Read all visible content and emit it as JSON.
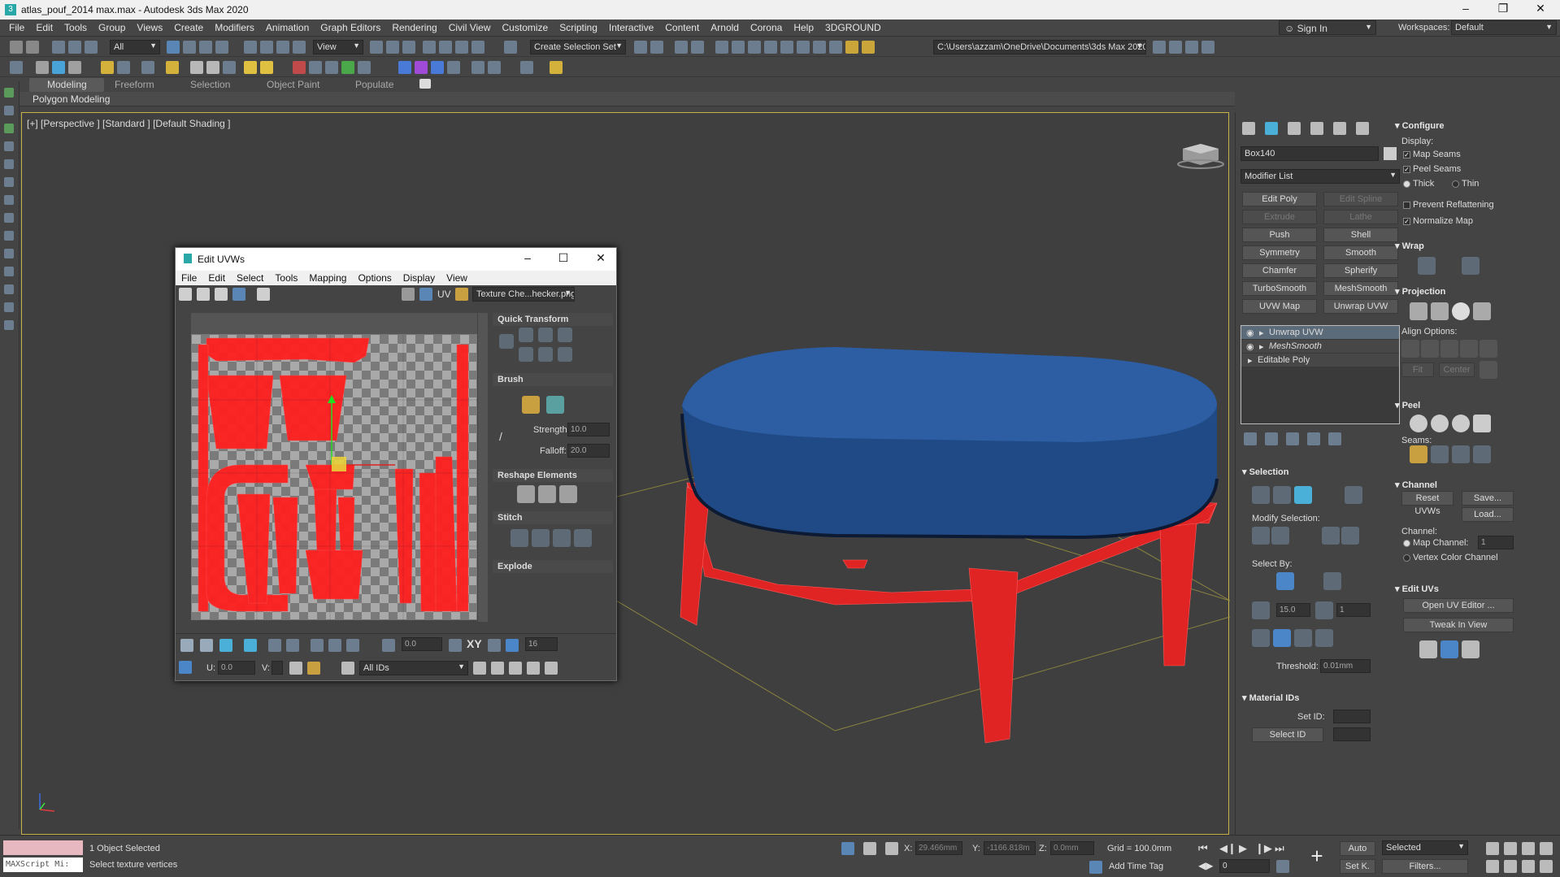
{
  "window": {
    "title": "atlas_pouf_2014 max.max - Autodesk 3ds Max 2020"
  },
  "menubar": {
    "items": [
      "File",
      "Edit",
      "Tools",
      "Group",
      "Views",
      "Create",
      "Modifiers",
      "Animation",
      "Graph Editors",
      "Rendering",
      "Civil View",
      "Customize",
      "Scripting",
      "Interactive",
      "Content",
      "Arnold",
      "Corona",
      "Help",
      "3DGROUND"
    ],
    "signin": "Sign In",
    "workspaces_label": "Workspaces:",
    "workspace": "Default"
  },
  "toolbar": {
    "selection_filter": "All",
    "ref_coord": "View",
    "selection_set": "Create Selection Set",
    "project_path": "C:\\Users\\azzam\\OneDrive\\Documents\\3ds Max 2020"
  },
  "ribbon": {
    "tabs": [
      "Modeling",
      "Freeform",
      "Selection",
      "Object Paint",
      "Populate"
    ],
    "active": "Modeling",
    "sub": "Polygon Modeling"
  },
  "viewport": {
    "label": "[+] [Perspective ] [Standard ] [Default Shading ]"
  },
  "uvw": {
    "title": "Edit UVWs",
    "menu": [
      "File",
      "Edit",
      "Select",
      "Tools",
      "Mapping",
      "Options",
      "Display",
      "View"
    ],
    "uv_label": "UV",
    "texture": "Texture Che...hecker.png)",
    "quick_transform": "Quick Transform",
    "brush": "Brush",
    "strength_label": "Strength:",
    "strength": "10.0",
    "falloff_label": "Falloff:",
    "falloff": "20.0",
    "reshape": "Reshape Elements",
    "stitch": "Stitch",
    "explode": "Explode",
    "xy_label": "XY",
    "spin_zero": "0.0",
    "spin_16": "16",
    "u_label": "U:",
    "u_value": "0.0",
    "v_label": "V:",
    "ids": "All IDs"
  },
  "cmd": {
    "object_name": "Box140",
    "modifier_list": "Modifier List",
    "buttons": [
      [
        "Edit Poly",
        "Edit Spline"
      ],
      [
        "Extrude",
        "Lathe"
      ],
      [
        "Push",
        "Shell"
      ],
      [
        "Symmetry",
        "Smooth"
      ],
      [
        "Chamfer",
        "Spherify"
      ],
      [
        "TurboSmooth",
        "MeshSmooth"
      ],
      [
        "UVW Map",
        "Unwrap UVW"
      ]
    ],
    "disabled": [
      "Edit Spline",
      "Extrude",
      "Lathe"
    ],
    "stack": [
      "Unwrap UVW",
      "MeshSmooth",
      "Editable Poly"
    ],
    "selection": "Selection",
    "modify_selection": "Modify Selection:",
    "select_by": "Select By:",
    "angle_value": "15.0",
    "count_value": "1",
    "threshold_label": "Threshold:",
    "threshold": "0.01mm",
    "material_ids": "Material IDs",
    "set_id_label": "Set ID:",
    "select_id": "Select ID",
    "configure": "Configure",
    "display": "Display:",
    "map_seams": "Map Seams",
    "peel_seams": "Peel Seams",
    "thick": "Thick",
    "thin": "Thin",
    "prevent_reflattening": "Prevent Reflattening",
    "normalize_map": "Normalize Map",
    "wrap": "Wrap",
    "projection": "Projection",
    "align_options": "Align Options:",
    "fit": "Fit",
    "center": "Center",
    "peel": "Peel",
    "seams": "Seams:",
    "channel": "Channel",
    "reset_uvws": "Reset UVWs",
    "save": "Save...",
    "load": "Load...",
    "channel_label": "Channel:",
    "map_channel": "Map Channel:",
    "map_channel_value": "1",
    "vertex_color_channel": "Vertex Color Channel",
    "edit_uvs": "Edit UVs",
    "open_uv_editor": "Open UV Editor ...",
    "tweak_in_view": "Tweak In View"
  },
  "status": {
    "maxscript": "MAXScript Mi:",
    "objects_selected": "1 Object Selected",
    "prompt": "Select texture vertices",
    "x_label": "X:",
    "x": "29.466mm",
    "y_label": "Y:",
    "y": "-1166.818m",
    "z_label": "Z:",
    "z": "0.0mm",
    "grid": "Grid = 100.0mm",
    "add_time_tag": "Add Time Tag",
    "auto": "Auto",
    "selected": "Selected",
    "setk": "Set K.",
    "filters": "Filters...",
    "frame": "0"
  }
}
